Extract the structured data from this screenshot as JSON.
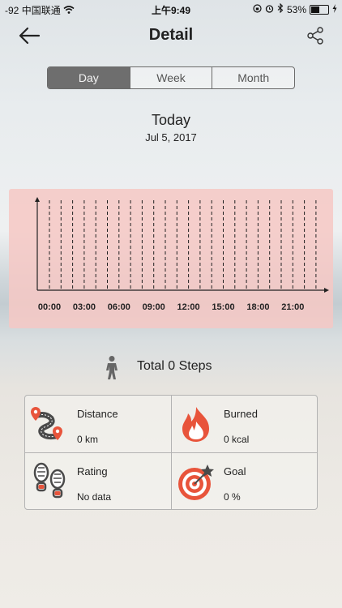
{
  "status_bar": {
    "signal": "-92",
    "carrier": "中国联通",
    "time": "上午9:49",
    "battery_percent": "53%",
    "battery_level": 0.53
  },
  "nav": {
    "title": "Detail"
  },
  "tabs": [
    {
      "label": "Day",
      "active": true
    },
    {
      "label": "Week",
      "active": false
    },
    {
      "label": "Month",
      "active": false
    }
  ],
  "date": {
    "title": "Today",
    "subtitle": "Jul 5, 2017"
  },
  "chart_data": {
    "type": "bar",
    "x_ticks": [
      "00:00",
      "03:00",
      "06:00",
      "09:00",
      "12:00",
      "15:00",
      "18:00",
      "21:00"
    ],
    "slots": 24,
    "values": [
      0,
      0,
      0,
      0,
      0,
      0,
      0,
      0,
      0,
      0,
      0,
      0,
      0,
      0,
      0,
      0,
      0,
      0,
      0,
      0,
      0,
      0,
      0,
      0
    ],
    "grid": true,
    "background": "#f6c8c4"
  },
  "summary": {
    "steps_label": "Total 0 Steps"
  },
  "stats": {
    "distance": {
      "title": "Distance",
      "value": "0 km"
    },
    "burned": {
      "title": "Burned",
      "value": "0 kcal"
    },
    "rating": {
      "title": "Rating",
      "value": "No data"
    },
    "goal": {
      "title": "Goal",
      "value": "0 %"
    }
  },
  "colors": {
    "accent": "#e8543b",
    "icon_dark": "#555555"
  }
}
